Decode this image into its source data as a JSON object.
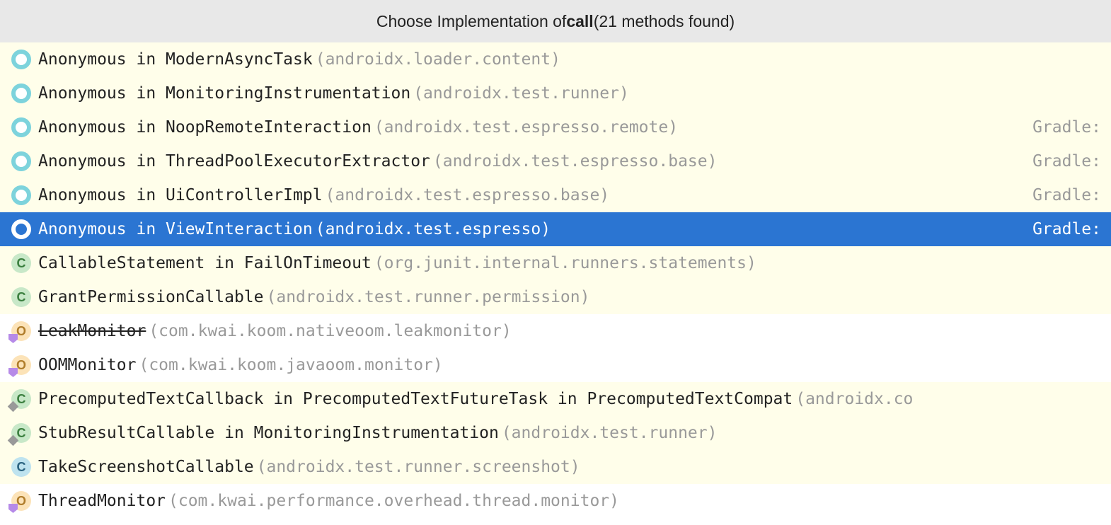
{
  "header": {
    "prefix": "Choose Implementation of ",
    "bold": "call",
    "suffix": " (21 methods found)"
  },
  "items": [
    {
      "icon": "ring",
      "name": "Anonymous in ModernAsyncTask",
      "pkg": "(androidx.loader.content)",
      "right": "",
      "bg": "yellow",
      "selected": false,
      "strike": false,
      "badge": ""
    },
    {
      "icon": "ring",
      "name": "Anonymous in MonitoringInstrumentation",
      "pkg": "(androidx.test.runner)",
      "right": "",
      "bg": "yellow",
      "selected": false,
      "strike": false,
      "badge": ""
    },
    {
      "icon": "ring",
      "name": "Anonymous in NoopRemoteInteraction",
      "pkg": "(androidx.test.espresso.remote)",
      "right": "Gradle:",
      "bg": "yellow",
      "selected": false,
      "strike": false,
      "badge": ""
    },
    {
      "icon": "ring",
      "name": "Anonymous in ThreadPoolExecutorExtractor",
      "pkg": "(androidx.test.espresso.base)",
      "right": "Gradle:",
      "bg": "yellow",
      "selected": false,
      "strike": false,
      "badge": ""
    },
    {
      "icon": "ring",
      "name": "Anonymous in UiControllerImpl",
      "pkg": "(androidx.test.espresso.base)",
      "right": "Gradle:",
      "bg": "yellow",
      "selected": false,
      "strike": false,
      "badge": ""
    },
    {
      "icon": "ring",
      "name": "Anonymous in ViewInteraction",
      "pkg": "(androidx.test.espresso)",
      "right": "Gradle:",
      "bg": "yellow",
      "selected": true,
      "strike": false,
      "badge": ""
    },
    {
      "icon": "c",
      "name": "CallableStatement in FailOnTimeout",
      "pkg": "(org.junit.internal.runners.statements)",
      "right": "",
      "bg": "yellow",
      "selected": false,
      "strike": false,
      "badge": ""
    },
    {
      "icon": "c",
      "name": "GrantPermissionCallable",
      "pkg": "(androidx.test.runner.permission)",
      "right": "",
      "bg": "yellow",
      "selected": false,
      "strike": false,
      "badge": ""
    },
    {
      "icon": "o",
      "name": "LeakMonitor",
      "pkg": "(com.kwai.koom.nativeoom.leakmonitor)",
      "right": "",
      "bg": "white",
      "selected": false,
      "strike": true,
      "badge": "purple"
    },
    {
      "icon": "o",
      "name": "OOMMonitor",
      "pkg": "(com.kwai.koom.javaoom.monitor)",
      "right": "",
      "bg": "white",
      "selected": false,
      "strike": false,
      "badge": "purple"
    },
    {
      "icon": "c",
      "name": "PrecomputedTextCallback in PrecomputedTextFutureTask in PrecomputedTextCompat",
      "pkg": "(androidx.co",
      "right": "",
      "bg": "yellow",
      "selected": false,
      "strike": false,
      "badge": "gray"
    },
    {
      "icon": "c",
      "name": "StubResultCallable in MonitoringInstrumentation",
      "pkg": "(androidx.test.runner)",
      "right": "",
      "bg": "yellow",
      "selected": false,
      "strike": false,
      "badge": "gray"
    },
    {
      "icon": "c-blue",
      "name": "TakeScreenshotCallable",
      "pkg": "(androidx.test.runner.screenshot)",
      "right": "",
      "bg": "yellow",
      "selected": false,
      "strike": false,
      "badge": ""
    },
    {
      "icon": "o",
      "name": "ThreadMonitor",
      "pkg": "(com.kwai.performance.overhead.thread.monitor)",
      "right": "",
      "bg": "white",
      "selected": false,
      "strike": false,
      "badge": "purple"
    }
  ]
}
